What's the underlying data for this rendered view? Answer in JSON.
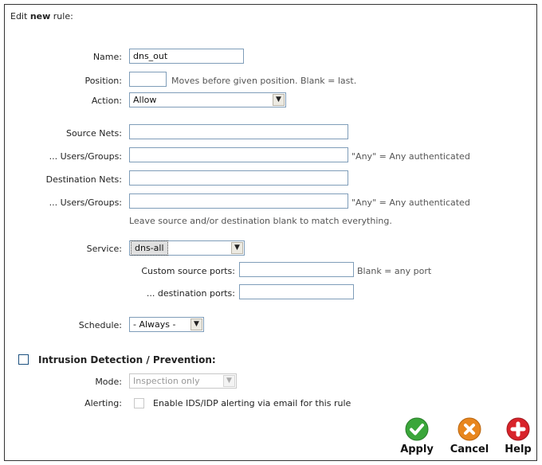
{
  "header": {
    "prefix": "Edit ",
    "strong": "new",
    "suffix": " rule:"
  },
  "fields": {
    "name": {
      "label": "Name:",
      "value": "dns_out"
    },
    "position": {
      "label": "Position:",
      "value": "",
      "hint": "Moves before given position. Blank = last."
    },
    "action": {
      "label": "Action:",
      "value": "Allow"
    },
    "source_nets": {
      "label": "Source Nets:",
      "value": ""
    },
    "source_users": {
      "label": "... Users/Groups:",
      "value": "",
      "hint": "\"Any\" = Any authenticated"
    },
    "dest_nets": {
      "label": "Destination Nets:",
      "value": ""
    },
    "dest_users": {
      "label": "... Users/Groups:",
      "value": "",
      "hint": "\"Any\" = Any authenticated"
    },
    "blank_note": "Leave source and/or destination blank to match everything.",
    "service": {
      "label": "Service:",
      "value": "dns-all"
    },
    "custom_source_ports": {
      "label": "Custom source ports:",
      "value": "",
      "hint": "Blank = any port"
    },
    "custom_dest_ports": {
      "label": "... destination ports:",
      "value": ""
    },
    "schedule": {
      "label": "Schedule:",
      "value": "- Always -"
    }
  },
  "idp": {
    "title": "Intrusion Detection / Prevention:",
    "mode_label": "Mode:",
    "mode_value": "Inspection only",
    "alerting_label": "Alerting:",
    "alerting_text": "Enable IDS/IDP alerting via email for this rule"
  },
  "buttons": {
    "apply": "Apply",
    "cancel": "Cancel",
    "help": "Help"
  },
  "colors": {
    "apply": "#3aa63a",
    "cancel": "#e8861e",
    "help": "#d8232a"
  },
  "icons": {
    "apply": "check-icon",
    "cancel": "x-icon",
    "help": "plus-icon",
    "dropdown": "chevron-down-icon"
  }
}
